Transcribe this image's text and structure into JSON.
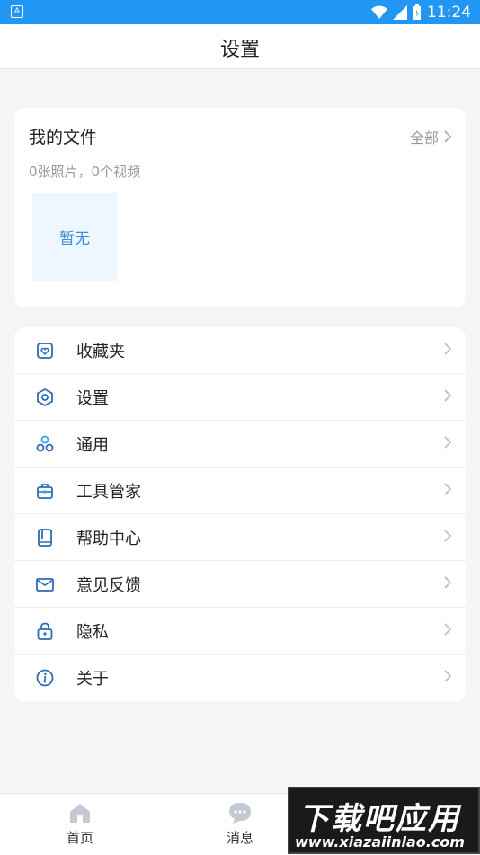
{
  "status_bar": {
    "time": "11:24",
    "left_icon_letter": "A"
  },
  "header": {
    "title": "设置"
  },
  "files": {
    "title": "我的文件",
    "all_label": "全部",
    "count_text": "0张照片，0个视频",
    "empty_text": "暂无"
  },
  "menu": {
    "items": [
      {
        "label": "收藏夹",
        "icon": "favorites-icon"
      },
      {
        "label": "设置",
        "icon": "settings-icon"
      },
      {
        "label": "通用",
        "icon": "general-icon"
      },
      {
        "label": "工具管家",
        "icon": "toolbox-icon"
      },
      {
        "label": "帮助中心",
        "icon": "help-book-icon"
      },
      {
        "label": "意见反馈",
        "icon": "mail-icon"
      },
      {
        "label": "隐私",
        "icon": "lock-icon"
      },
      {
        "label": "关于",
        "icon": "info-icon"
      }
    ]
  },
  "tabs": [
    {
      "label": "首页",
      "icon": "home-icon"
    },
    {
      "label": "消息",
      "icon": "message-icon"
    }
  ],
  "watermark": {
    "line1": "下载吧应用",
    "line2": "www.xiazaiinlao.com"
  },
  "colors": {
    "accent": "#2196f3",
    "link_blue": "#3b8fd9",
    "icon_blue": "#2d6bb5"
  }
}
